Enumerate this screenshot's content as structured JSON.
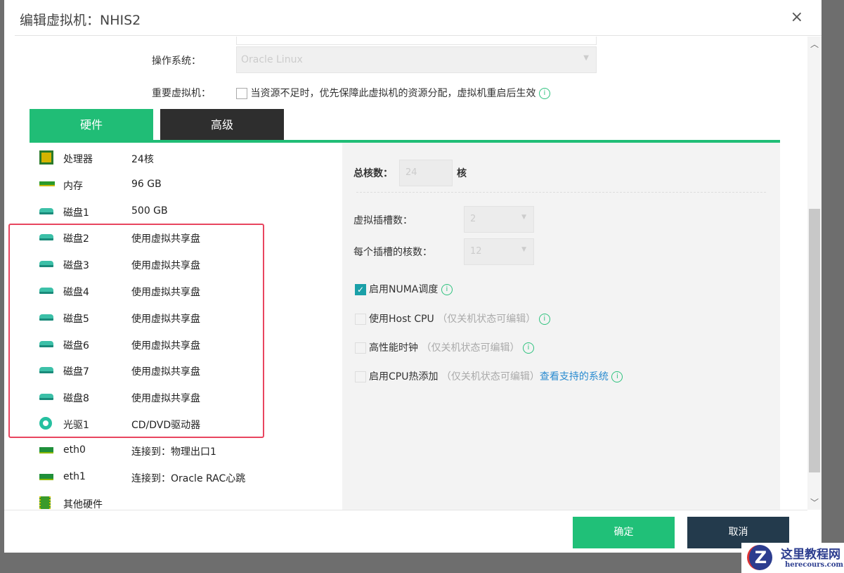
{
  "dialog": {
    "title": "编辑虚拟机：NHIS2",
    "close": "×"
  },
  "form": {
    "os_label": "操作系统：",
    "os_value": "Oracle Linux",
    "important_label": "重要虚拟机：",
    "important_text": "当资源不足时，优先保障此虚拟机的资源分配，虚拟机重启后生效"
  },
  "tabs": [
    {
      "label": "硬件"
    },
    {
      "label": "高级"
    }
  ],
  "hardware": [
    {
      "name": "处理器",
      "value": "24核",
      "icon": "cpu-icon"
    },
    {
      "name": "内存",
      "value": "96 GB",
      "icon": "memory-icon"
    },
    {
      "name": "磁盘1",
      "value": "500 GB",
      "icon": "disk-icon"
    },
    {
      "name": "磁盘2",
      "value": "使用虚拟共享盘",
      "icon": "disk-icon"
    },
    {
      "name": "磁盘3",
      "value": "使用虚拟共享盘",
      "icon": "disk-icon"
    },
    {
      "name": "磁盘4",
      "value": "使用虚拟共享盘",
      "icon": "disk-icon"
    },
    {
      "name": "磁盘5",
      "value": "使用虚拟共享盘",
      "icon": "disk-icon"
    },
    {
      "name": "磁盘6",
      "value": "使用虚拟共享盘",
      "icon": "disk-icon"
    },
    {
      "name": "磁盘7",
      "value": "使用虚拟共享盘",
      "icon": "disk-icon"
    },
    {
      "name": "磁盘8",
      "value": "使用虚拟共享盘",
      "icon": "disk-icon"
    },
    {
      "name": "光驱1",
      "value": "CD/DVD驱动器",
      "icon": "cdrom-icon"
    },
    {
      "name": "eth0",
      "value": "连接到：物理出口1",
      "icon": "nic-icon"
    },
    {
      "name": "eth1",
      "value": "连接到：Oracle RAC心跳",
      "icon": "nic-icon"
    },
    {
      "name": "其他硬件",
      "value": "",
      "icon": "chip-icon"
    }
  ],
  "cpu": {
    "total_label": "总核数：",
    "total_value": "24",
    "unit": "核",
    "sockets_label": "虚拟插槽数：",
    "sockets_value": "2",
    "cores_label": "每个插槽的核数：",
    "cores_value": "12",
    "numa_label": "启用NUMA调度",
    "host_cpu_label": "使用Host CPU",
    "host_cpu_note": "（仅关机状态可编辑）",
    "hpet_label": "高性能时钟",
    "hpet_note": "（仅关机状态可编辑）",
    "hotplug_label": "启用CPU热添加",
    "hotplug_note": "（仅关机状态可编辑）",
    "hotplug_link": "查看支持的系统"
  },
  "footer": {
    "ok": "确定",
    "cancel": "取消"
  },
  "watermark": {
    "title": "这里教程网",
    "url": "herecours.com"
  }
}
